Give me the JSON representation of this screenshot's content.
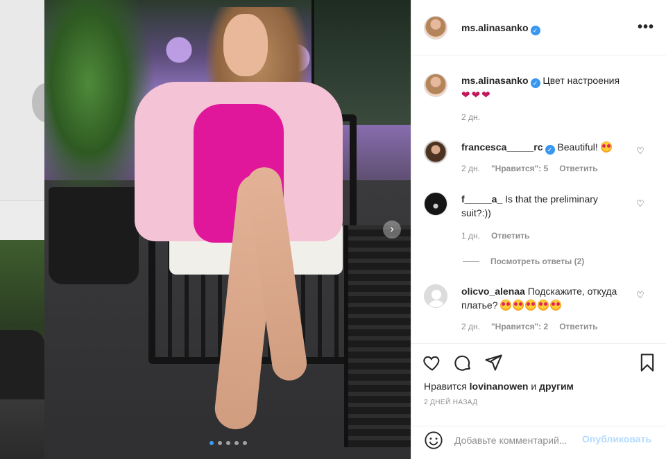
{
  "post": {
    "username": "ms.alinasanko",
    "more_label": "•••",
    "carousel": {
      "count": 5,
      "active": 0,
      "next_icon": "chevron-right-icon"
    }
  },
  "caption": {
    "username": "ms.alinasanko",
    "text": "Цвет настроения",
    "hearts": "❤❤❤",
    "time": "2 дн."
  },
  "comments": [
    {
      "username": "francesca_____rc",
      "verified": true,
      "text": "Beautiful!",
      "emoji_count": 1,
      "time": "2 дн.",
      "likes": "\"Нравится\": 5",
      "reply": "Ответить"
    },
    {
      "username": "f_____a_",
      "verified": false,
      "text": "Is that the preliminary suit?:))",
      "emoji_count": 0,
      "time": "1 дн.",
      "likes": "",
      "reply": "Ответить"
    },
    {
      "username": "olicvo_alenaa",
      "verified": false,
      "text": "Подскажите, откуда платье?",
      "emoji_count": 5,
      "time": "2 дн.",
      "likes": "\"Нравится\": 2",
      "reply": "Ответить"
    }
  ],
  "view_replies": "Посмотреть ответы (2)",
  "likes": {
    "prefix": "Нравится",
    "user": "lovinanowen",
    "suffix": "и",
    "others": "другим"
  },
  "date": "2 ДНЕЙ НАЗАД",
  "add_comment": {
    "placeholder": "Добавьте комментарий...",
    "publish": "Опубликовать"
  },
  "colors": {
    "accent": "#3897f0",
    "publish_disabled": "#b3dbff",
    "muted": "#8e8e8e"
  }
}
